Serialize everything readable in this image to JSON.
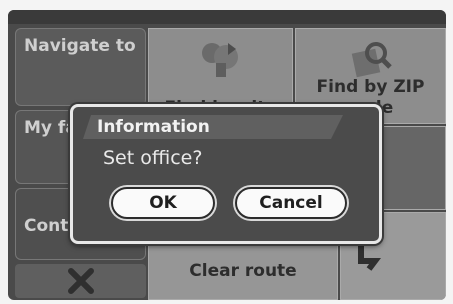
{
  "nav": {
    "navigate_to": "Navigate to",
    "my_favorites": "My fav",
    "contacts": "Cont",
    "close_icon": "close-icon"
  },
  "grid": {
    "find_by_city": "Find by city",
    "find_by_zip": "Find by ZIP code",
    "clear_route": "Clear route"
  },
  "dialog": {
    "title": "Information",
    "message": "Set office?",
    "ok_label": "OK",
    "cancel_label": "Cancel"
  },
  "colors": {
    "screen_bg": "#4a4a4a",
    "dialog_border": "#e8e8e8",
    "button_bg": "#fafafa"
  }
}
